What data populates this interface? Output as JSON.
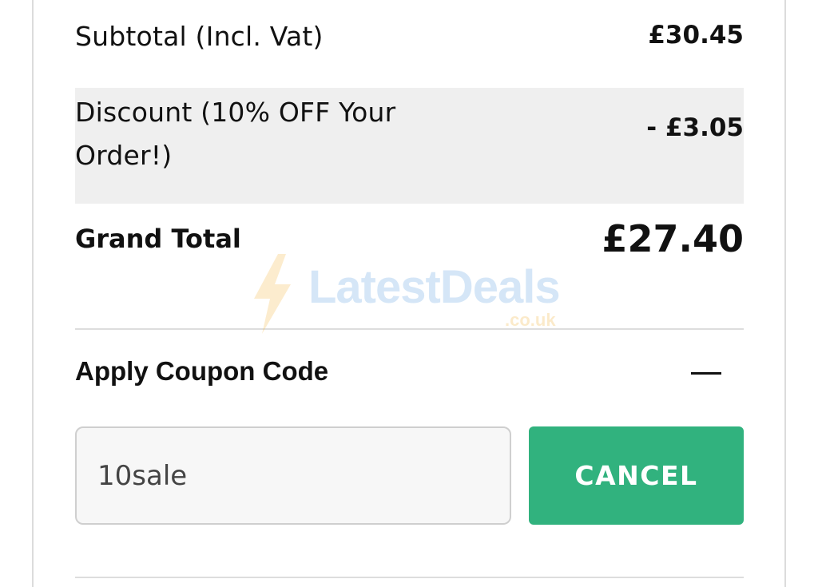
{
  "summary": {
    "subtotal_label": "Subtotal (Incl. Vat)",
    "subtotal_value": "£30.45",
    "discount_label": "Discount (10% OFF Your Order!)",
    "discount_value": "- £3.05",
    "grand_total_label": "Grand Total",
    "grand_total_value": "£27.40"
  },
  "watermark": {
    "brand": "LatestDeals",
    "domain": ".co.uk",
    "icon": "lightning-bolt-icon"
  },
  "coupon": {
    "title": "Apply Coupon Code",
    "toggle_icon": "minus-icon",
    "input_value": "10sale",
    "cancel_label": "CANCEL"
  },
  "colors": {
    "accent": "#31b27e",
    "discount_row_bg": "#efefef"
  }
}
